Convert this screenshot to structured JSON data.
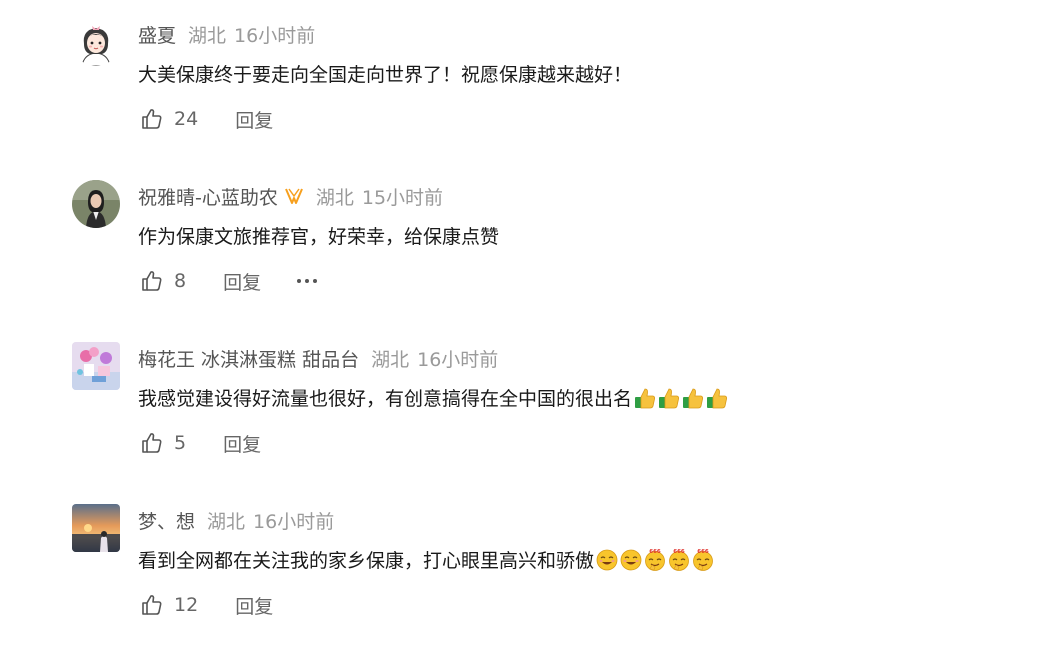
{
  "comments": [
    {
      "username": "盛夏",
      "location": "湖北",
      "time": "16小时前",
      "text": "大美保康终于要走向全国走向世界了！祝愿保康越来越好！",
      "likes": "24",
      "reply_label": "回复",
      "avatar": "cartoon-girl-avatar"
    },
    {
      "username": "祝雅晴-心蓝助农",
      "badge": "vip-badge-icon",
      "location": "湖北",
      "time": "15小时前",
      "text": "作为保康文旅推荐官，好荣幸，给保康点赞",
      "likes": "8",
      "reply_label": "回复",
      "more": "more-icon",
      "avatar": "photo-woman-avatar"
    },
    {
      "username": "梅花王 冰淇淋蛋糕 甜品台",
      "location": "湖北",
      "time": "16小时前",
      "text": "我感觉建设得好流量也很好，有创意搞得在全中国的很出名",
      "emojis": [
        "thumbs-up-icon",
        "thumbs-up-icon",
        "thumbs-up-icon",
        "thumbs-up-icon"
      ],
      "likes": "5",
      "reply_label": "回复",
      "avatar": "dessert-table-avatar"
    },
    {
      "username": "梦、想",
      "location": "湖北",
      "time": "16小时前",
      "text": "看到全网都在关注我的家乡保康，打心眼里高兴和骄傲",
      "emojis": [
        "laugh-face-icon",
        "laugh-face-icon",
        "666-face-icon",
        "666-face-icon",
        "666-face-icon"
      ],
      "likes": "12",
      "reply_label": "回复",
      "avatar": "sunset-photo-avatar"
    }
  ],
  "colors": {
    "username": "#555555",
    "meta": "#9a9a9a",
    "text": "#1a1a1a",
    "action": "#666666",
    "badge": "#f7a01e",
    "emoji_face": "#f8c52c",
    "emoji_666": "#e0302a"
  }
}
